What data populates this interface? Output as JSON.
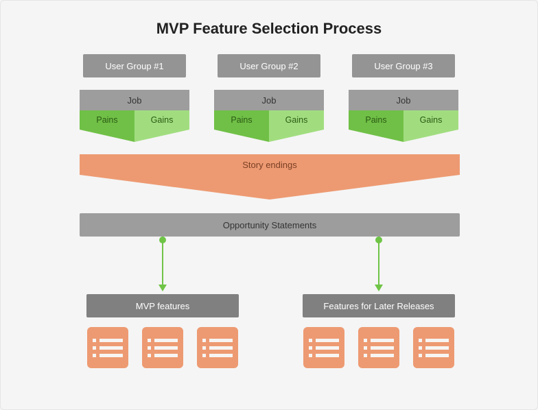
{
  "title": "MVP Feature Selection Process",
  "groups": [
    {
      "name": "User Group #1",
      "job": "Job",
      "pain": "Pains",
      "gain": "Gains"
    },
    {
      "name": "User Group #2",
      "job": "Job",
      "pain": "Pains",
      "gain": "Gains"
    },
    {
      "name": "User Group #3",
      "job": "Job",
      "pain": "Pains",
      "gain": "Gains"
    }
  ],
  "funnel_label": "Story endings",
  "opportunity_label": "Opportunity Statements",
  "mvp_label": "MVP features",
  "later_label": "Features for Later Releases",
  "colors": {
    "grey": "#9d9d9d",
    "dark_grey": "#808080",
    "green_dark": "#70c047",
    "green_light": "#a1dd7f",
    "salmon": "#ed9a72",
    "arrow": "#6fc446"
  }
}
